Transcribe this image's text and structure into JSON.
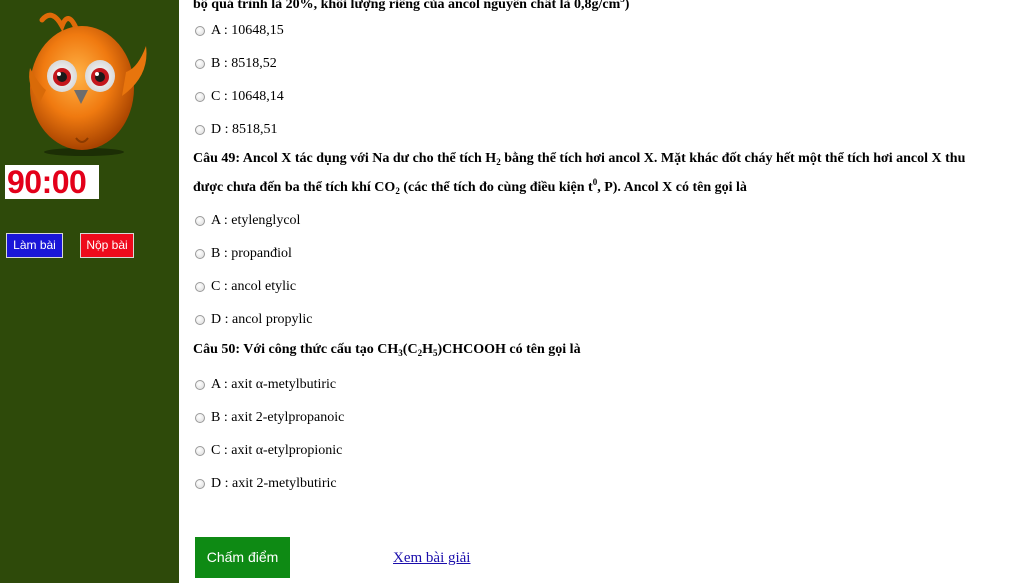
{
  "sidebar": {
    "timer": "90:00",
    "btn_lam_bai": "Làm bài",
    "btn_nop_bai": "Nộp bài"
  },
  "q48": {
    "text_cut": "bộ quá trình là 20%, khối lượng riêng của ancol nguyên chất là 0,8g/cm",
    "sup": "3",
    "text_end": ")",
    "options": [
      "A : 10648,15",
      "B : 8518,52",
      "C : 10648,14",
      "D : 8518,51"
    ]
  },
  "q49": {
    "line1_a": "Câu 49: Ancol X tác dụng với Na dư cho thể tích H",
    "line1_sub": "2",
    "line1_b": " bằng thể tích hơi ancol X. Mặt khác đốt cháy hết một thể tích hơi ancol X thu",
    "line2_a": "được chưa đến ba thể tích khí CO",
    "line2_sub": "2",
    "line2_b": " (các thể tích  đo cùng điều kiện t",
    "line2_sup": "0",
    "line2_c": ", P). Ancol X có tên gọi là",
    "options": [
      "A : etylenglycol",
      "B : propanđiol",
      "C : ancol etylic",
      "D : ancol propylic"
    ]
  },
  "q50": {
    "t1": "Câu 50: Với công thức cấu tạo CH",
    "s1": "3",
    "t2": "(C",
    "s2": "2",
    "t3": "H",
    "s3": "5",
    "t4": ")CHCOOH có tên gọi là",
    "options": [
      "A : axit α-metylbutiric",
      "B : axit 2-etylpropanoic",
      "C : axit α-etylpropionic",
      "D : axit 2-metylbutiric"
    ]
  },
  "footer": {
    "btn_cham_diem": "Chấm điểm",
    "link_xem_giai": "Xem bài giải"
  }
}
